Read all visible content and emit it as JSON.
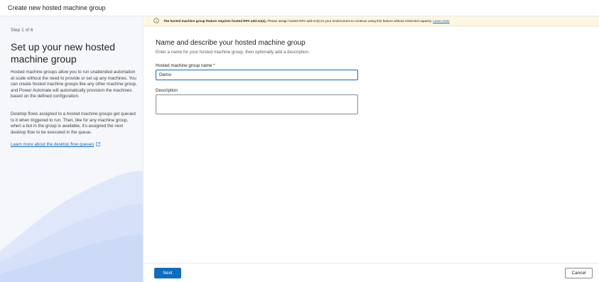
{
  "window": {
    "title": "Create new hosted machine group"
  },
  "sidebar": {
    "step": "Step 1 of 6",
    "heading": "Set up your new hosted machine group",
    "description_1": "Hosted machine groups allow you to run unattended automation at scale without the need to provide or set up any machines. You can create hosted machine groups like any other machine group, and Power Automate will automatically provision the machines based on the defined configuration.",
    "description_2": "Desktop flows assigned to a hosted machine groups get queued to it when triggered to run. Then, like for any machine group, when a bot in the group is available, it's assigned the next desktop flow to be executed in the queue.",
    "learn_more_link": "Learn more about the desktop flow queues",
    "link_icon": "external-link-icon"
  },
  "banner": {
    "icon": "info-icon",
    "bold_text": "The hosted machine group feature requires hosted RPA add-on(s).",
    "text": " Please assign hosted RPA add-on(s) to your environment to continue using this feature without restricted capacity.",
    "link": "Learn more"
  },
  "main": {
    "title": "Name and describe your hosted machine group",
    "subtitle": "Enter a name for your hosted machine group, then optionally add a description.",
    "name_label": "Hosted machine group name *",
    "name_value": "Demo",
    "description_label": "Description",
    "description_value": ""
  },
  "footer": {
    "next_label": "Next",
    "cancel_label": "Cancel"
  },
  "colors": {
    "accent": "#0f6cbd",
    "banner_bg": "#fdf6e1",
    "sidebar_bg": "#f5f7fb"
  }
}
